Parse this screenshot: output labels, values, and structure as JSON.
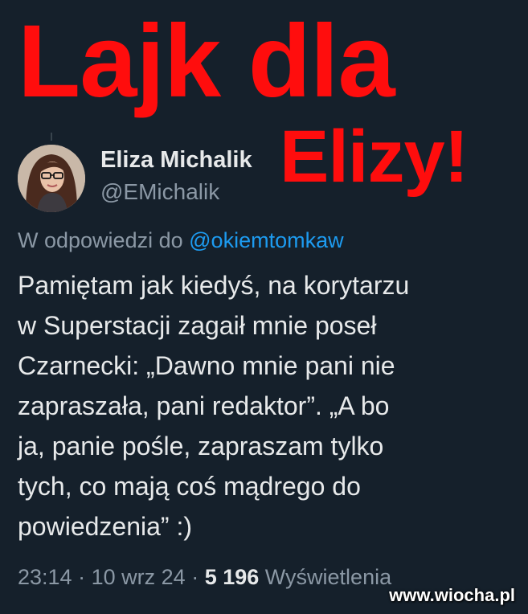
{
  "headline": {
    "line1": "Lajk dla",
    "line2": "Elizy!",
    "color": "#ff0d0d"
  },
  "tweet": {
    "author_name": "Eliza Michalik",
    "author_handle": "@EMichalik",
    "reply_prefix": "W odpowiedzi do",
    "reply_handle": "@okiemtomkaw",
    "text_lines": [
      "Pamiętam jak kiedyś, na korytarzu",
      "w Superstacji zagaił mnie poseł",
      "Czarnecki: „Dawno mnie pani nie",
      "zapraszała, pani redaktor”. „A bo",
      "ja, panie pośle, zapraszam tylko",
      "tych, co mają coś mądrego do",
      "powiedzenia” :)"
    ],
    "time": "23:14",
    "separator": "·",
    "date": "10 wrz 24",
    "views_count": "5 196",
    "views_label": "Wyświetlenia"
  },
  "watermark": "www.wiocha.pl",
  "colors": {
    "background": "#15202b",
    "text": "#e7e9ea",
    "secondary": "#8b98a5",
    "link": "#1d9bf0"
  }
}
